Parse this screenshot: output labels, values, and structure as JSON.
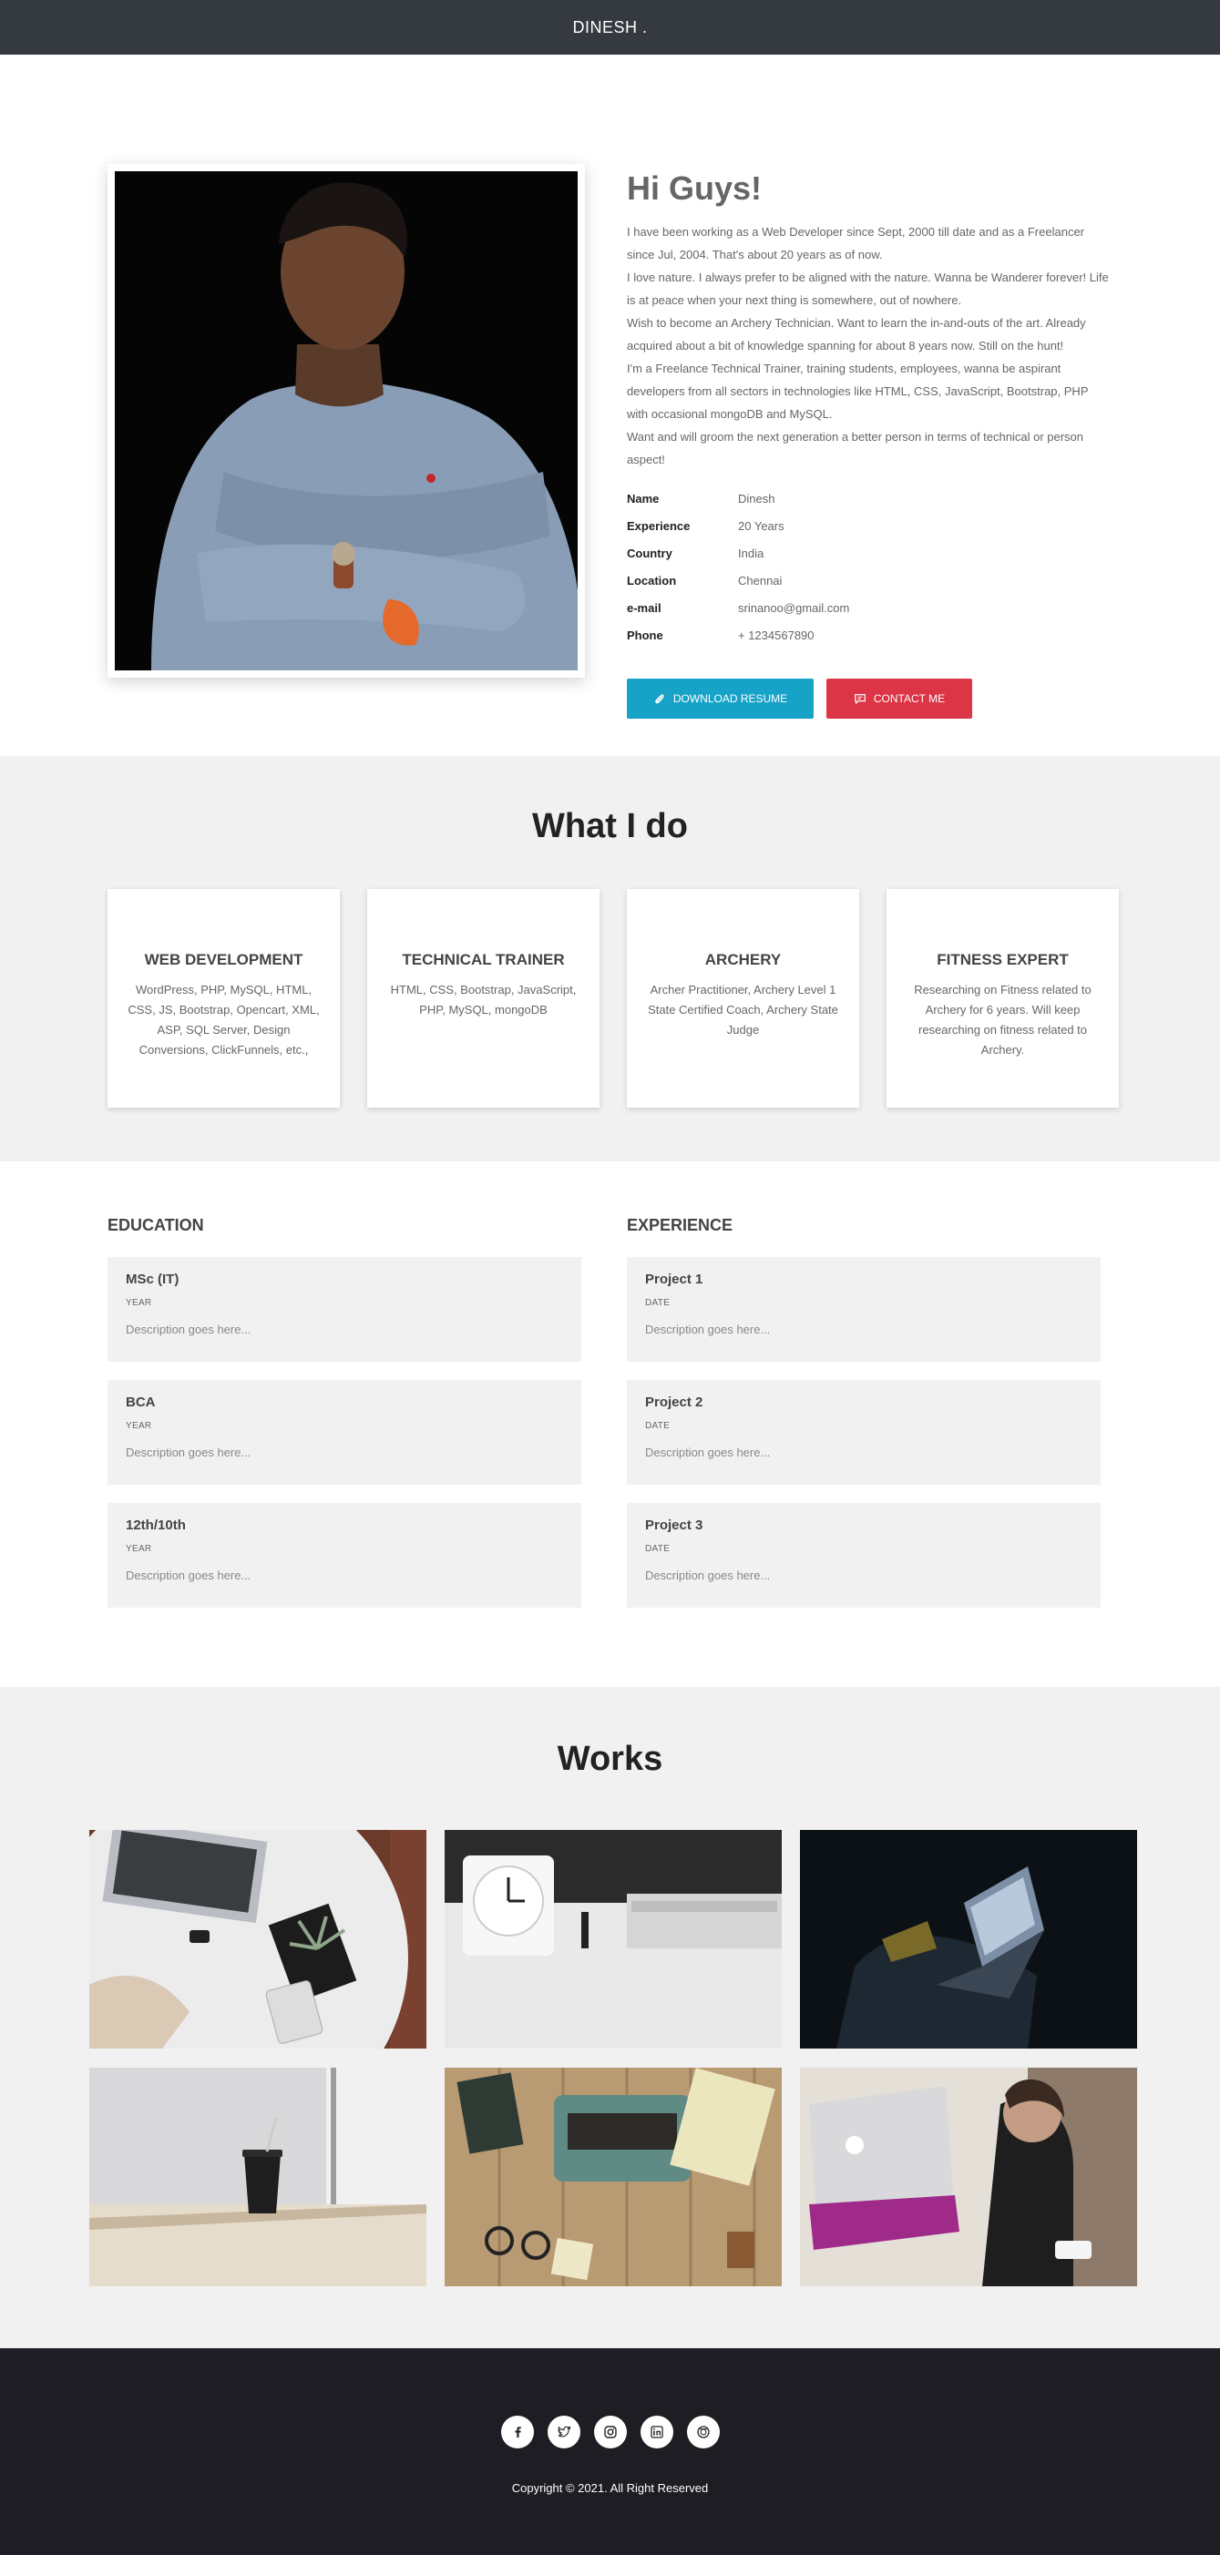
{
  "nav": {
    "brand": "DINESH ."
  },
  "about": {
    "greeting": "Hi Guys!",
    "bio": [
      "I have been working as a Web Developer since Sept, 2000 till date and as a Freelancer since Jul, 2004. That's about 20 years as of now.",
      "I love nature. I always prefer to be aligned with the nature. Wanna be Wanderer forever! Life is at peace when your next thing is somewhere, out of nowhere.",
      "Wish to become an Archery Technician. Want to learn the in-and-outs of the art. Already acquired about a bit of knowledge spanning for about 8 years now. Still on the hunt!",
      "I'm a Freelance Technical Trainer, training students, employees, wanna be aspirant developers from all sectors in technologies like HTML, CSS, JavaScript, Bootstrap, PHP with occasional mongoDB and MySQL.",
      "Want and will groom the next generation a better person in terms of technical or person aspect!"
    ],
    "info": [
      {
        "key": "Name",
        "value": "Dinesh"
      },
      {
        "key": "Experience",
        "value": "20 Years"
      },
      {
        "key": "Country",
        "value": "India"
      },
      {
        "key": "Location",
        "value": "Chennai"
      },
      {
        "key": "e-mail",
        "value": "srinanoo@gmail.com"
      },
      {
        "key": "Phone",
        "value": "+ 1234567890"
      }
    ],
    "download_label": "DOWNLOAD RESUME",
    "contact_label": "CONTACT ME",
    "accent_blue": "#17a2c7",
    "accent_red": "#dc3545"
  },
  "whatido": {
    "title": "What I do",
    "cards": [
      {
        "title": "WEB DEVELOPMENT",
        "text": "WordPress, PHP, MySQL, HTML, CSS, JS, Bootstrap, Opencart, XML, ASP, SQL Server, Design Conversions, ClickFunnels, etc.,"
      },
      {
        "title": "TECHNICAL TRAINER",
        "text": "HTML, CSS, Bootstrap, JavaScript, PHP, MySQL, mongoDB"
      },
      {
        "title": "ARCHERY",
        "text": "Archer Practitioner, Archery Level 1 State Certified Coach, Archery State Judge"
      },
      {
        "title": "FITNESS EXPERT",
        "text": "Researching on Fitness related to Archery for 6 years. Will keep researching on fitness related to Archery."
      }
    ]
  },
  "education": {
    "title": "EDUCATION",
    "items": [
      {
        "title": "MSc (IT)",
        "meta": "YEAR",
        "desc": "Description goes here..."
      },
      {
        "title": "BCA",
        "meta": "YEAR",
        "desc": "Description goes here..."
      },
      {
        "title": "12th/10th",
        "meta": "YEAR",
        "desc": "Description goes here..."
      }
    ]
  },
  "experience": {
    "title": "EXPERIENCE",
    "items": [
      {
        "title": "Project 1",
        "meta": "DATE",
        "desc": "Description goes here..."
      },
      {
        "title": "Project 2",
        "meta": "DATE",
        "desc": "Description goes here..."
      },
      {
        "title": "Project 3",
        "meta": "DATE",
        "desc": "Description goes here..."
      }
    ]
  },
  "works": {
    "title": "Works"
  },
  "footer": {
    "socials": [
      "facebook-icon",
      "twitter-icon",
      "instagram-icon",
      "linkedin-icon",
      "dribbble-icon"
    ],
    "copyright": "Copyright © 2021. All Right Reserved"
  }
}
